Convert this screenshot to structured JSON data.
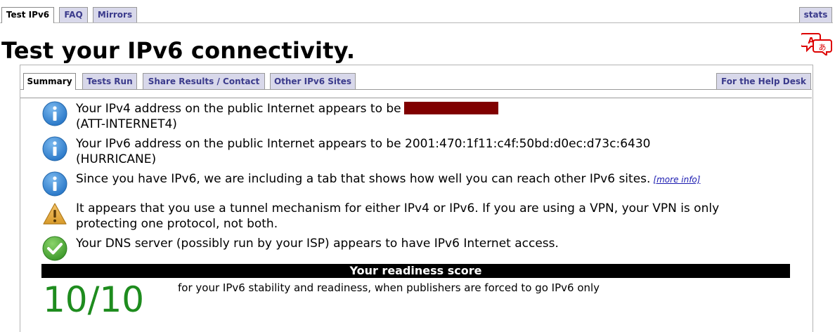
{
  "top_tabs": [
    {
      "label": "Test IPv6",
      "active": true
    },
    {
      "label": "FAQ",
      "active": false
    },
    {
      "label": "Mirrors",
      "active": false
    }
  ],
  "stats_tab": "stats",
  "page_title": "Test your IPv6 connectivity.",
  "translate_icon": "translate-icon",
  "panel_tabs": [
    {
      "label": "Summary",
      "active": true
    },
    {
      "label": "Tests Run",
      "active": false
    },
    {
      "label": "Share Results / Contact",
      "active": false
    },
    {
      "label": "Other IPv6 Sites",
      "active": false
    }
  ],
  "help_desk_tab": "For the Help Desk",
  "messages": [
    {
      "icon": "info-icon",
      "line1": "Your IPv4 address on the public Internet appears to be",
      "line2": "(ATT-INTERNET4)"
    },
    {
      "icon": "info-icon",
      "line1": "Your IPv6 address on the public Internet appears to be 2001:470:1f11:c4f:50bd:d0ec:d73c:6430",
      "line2": "(HURRICANE)"
    },
    {
      "icon": "info-icon",
      "line1": "Since you have IPv6, we are including a tab that shows how well you can reach other IPv6 sites.",
      "link": "[more info]"
    },
    {
      "icon": "warning-icon",
      "line1": "It appears that you use a tunnel mechanism for either IPv4 or IPv6. If you are using a VPN, your VPN is only",
      "line2": "protecting one protocol, not both."
    },
    {
      "icon": "check-icon",
      "line1": "Your DNS server (possibly run by your ISP) appears to have IPv6 Internet access."
    }
  ],
  "readiness": {
    "header": "Your readiness score",
    "score": "10/10",
    "description": "for your IPv6 stability and readiness, when publishers are forced to go IPv6 only"
  },
  "colors": {
    "tab_bg": "#d8d8ea",
    "tab_text": "#3b3b8c",
    "score_green": "#1e8c1e",
    "redaction": "#800000"
  }
}
